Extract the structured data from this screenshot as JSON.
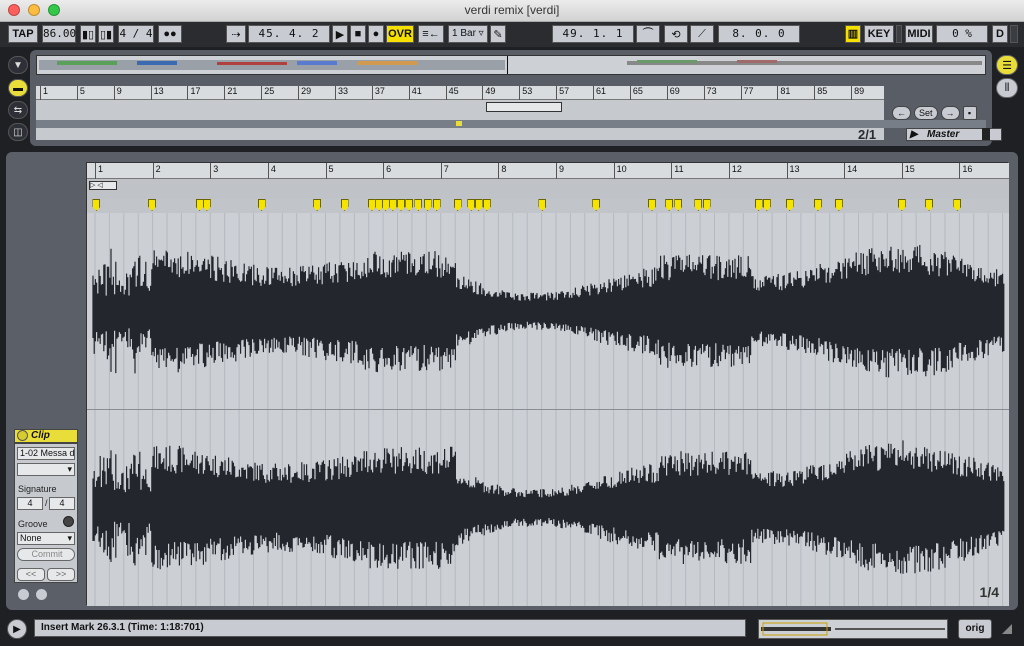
{
  "window": {
    "title": "verdi remix  [verdi]"
  },
  "control_bar": {
    "tap": "TAP",
    "tempo": "86.00",
    "signature": "4 / 4",
    "arrangement_position": "45.  4.  2",
    "ovr": "OVR",
    "quantize": "1 Bar",
    "loop_start": "49.  1.  1",
    "loop_length": "8.  0.  0",
    "key": "KEY",
    "midi": "MIDI",
    "cpu": "0 %",
    "d": "D"
  },
  "arrangement": {
    "ruler_marks": [
      "1",
      "5",
      "9",
      "13",
      "17",
      "21",
      "25",
      "29",
      "33",
      "37",
      "41",
      "45",
      "49",
      "53",
      "57",
      "61",
      "65",
      "69",
      "73",
      "77",
      "81",
      "85",
      "89"
    ],
    "set_label": "Set",
    "position": "2/1",
    "master_label": "Master"
  },
  "clip": {
    "title": "Clip",
    "name": "1-02 Messa d",
    "signature_label": "Signature",
    "sig_num": "4",
    "sig_den": "4",
    "groove_label": "Groove",
    "groove_value": "None",
    "commit": "Commit",
    "nudge_left": "<<",
    "nudge_right": ">>"
  },
  "detail": {
    "ruler_marks": [
      "1",
      "2",
      "3",
      "4",
      "5",
      "6",
      "7",
      "8",
      "9",
      "10",
      "11",
      "12",
      "13",
      "14",
      "15",
      "16"
    ],
    "page": "1/4",
    "markers": [
      0.6,
      6.7,
      11.9,
      12.7,
      18.7,
      24.8,
      27.8,
      30.8,
      31.6,
      32.3,
      33.1,
      34,
      34.9,
      35.9,
      36.9,
      37.9,
      40.2,
      41.7,
      42.5,
      43.4,
      49.5,
      55.4,
      61.5,
      63.4,
      64.4,
      66.6,
      67.5,
      73.2,
      74.1,
      76.6,
      79.7,
      82,
      88.9,
      91.9,
      95
    ]
  },
  "status_bar": {
    "message": "Insert Mark 26.3.1 (Time: 1:18:701)",
    "orig": "orig"
  },
  "colors": {
    "accent": "#e9dd3a",
    "waveform": "#23262d",
    "panel": "#5b6068"
  }
}
